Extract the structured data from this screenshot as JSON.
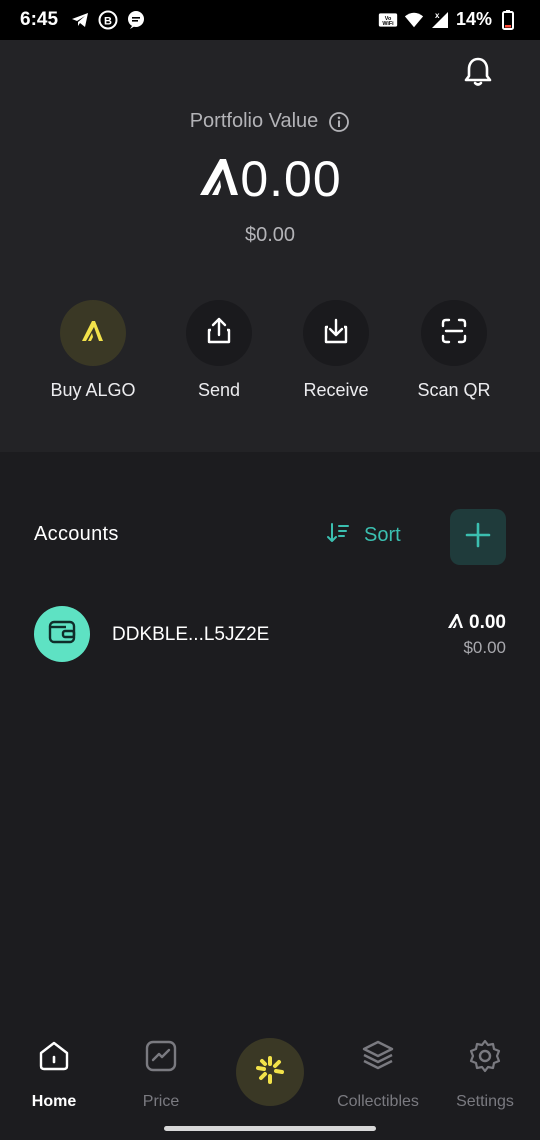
{
  "status_bar": {
    "time": "6:45",
    "battery_percent": "14%",
    "icons_left": [
      "telegram-icon",
      "b-circle-icon",
      "chat-bubble-icon"
    ],
    "icons_right": [
      "vowifi-icon",
      "wifi-icon",
      "signal-icon",
      "battery-icon"
    ]
  },
  "portfolio": {
    "label": "Portfolio Value",
    "algo_value": "0.00",
    "usd_value": "$0.00"
  },
  "actions": [
    {
      "label": "Buy ALGO",
      "icon": "algo-icon"
    },
    {
      "label": "Send",
      "icon": "share-up-icon"
    },
    {
      "label": "Receive",
      "icon": "download-icon"
    },
    {
      "label": "Scan QR",
      "icon": "scan-icon"
    }
  ],
  "accounts": {
    "title": "Accounts",
    "sort_label": "Sort",
    "items": [
      {
        "name": "DDKBLE...L5JZ2E",
        "algo_balance": "0.00",
        "usd_balance": "$0.00"
      }
    ]
  },
  "nav": {
    "items": [
      {
        "label": "Home",
        "icon": "home-icon",
        "active": true
      },
      {
        "label": "Price",
        "icon": "chart-icon",
        "active": false
      },
      {
        "label": "Collectibles",
        "icon": "layers-icon",
        "active": false
      },
      {
        "label": "Settings",
        "icon": "gear-icon",
        "active": false
      }
    ]
  },
  "colors": {
    "background": "#1c1c1f",
    "header": "#232326",
    "accent_teal": "#3bbfb0",
    "accent_yellow": "#f2e24a",
    "avatar": "#5ee2c3"
  }
}
